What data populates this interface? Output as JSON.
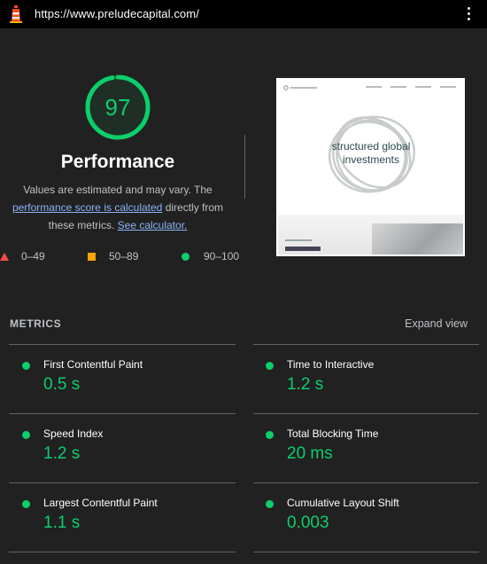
{
  "top_bar": {
    "url": "https://www.preludecapital.com/",
    "logo_icon": "lighthouse-icon",
    "menu_icon": "kebab-menu-icon"
  },
  "score": {
    "value": "97",
    "fraction": 0.97,
    "color": "#0cce6b",
    "title": "Performance",
    "desc_part1": "Values are estimated and may vary. The",
    "desc_link1": "performance score is calculated",
    "desc_part2": "directly from these metrics.",
    "desc_link2": "See calculator."
  },
  "legend": [
    {
      "range": "0–49",
      "shape": "triangle",
      "color": "#ff4e42"
    },
    {
      "range": "50–89",
      "shape": "square",
      "color": "#ffa400"
    },
    {
      "range": "90–100",
      "shape": "circle",
      "color": "#0cce6b"
    }
  ],
  "screenshot": {
    "headline_line1": "structured global",
    "headline_line2": "investments"
  },
  "metrics": {
    "heading": "METRICS",
    "expand_label": "Expand view",
    "items": [
      {
        "label": "First Contentful Paint",
        "value": "0.5 s"
      },
      {
        "label": "Time to Interactive",
        "value": "1.2 s"
      },
      {
        "label": "Speed Index",
        "value": "1.2 s"
      },
      {
        "label": "Total Blocking Time",
        "value": "20 ms"
      },
      {
        "label": "Largest Contentful Paint",
        "value": "1.1 s"
      },
      {
        "label": "Cumulative Layout Shift",
        "value": "0.003"
      }
    ]
  }
}
